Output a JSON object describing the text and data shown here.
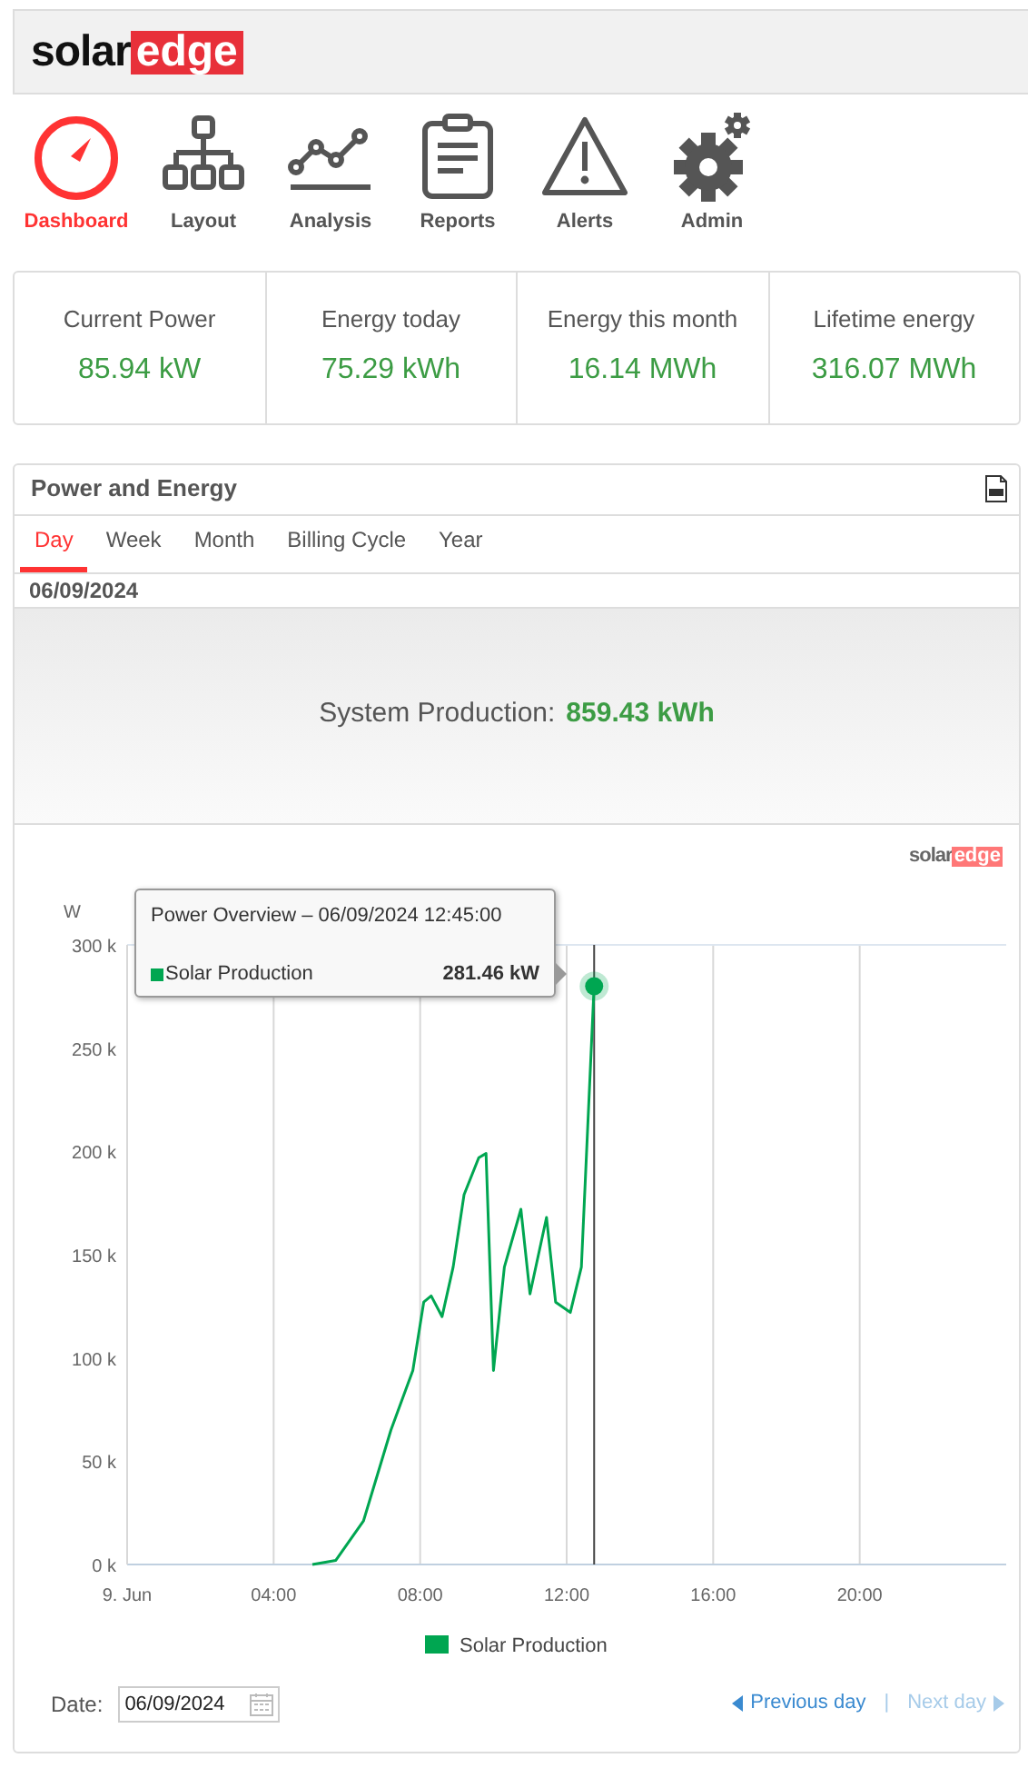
{
  "logo": {
    "part_1": "solar",
    "part_2": "edge"
  },
  "nav": [
    {
      "label": "Dashboard",
      "selected": true
    },
    {
      "label": "Layout",
      "selected": false
    },
    {
      "label": "Analysis",
      "selected": false
    },
    {
      "label": "Reports",
      "selected": false
    },
    {
      "label": "Alerts",
      "selected": false
    },
    {
      "label": "Admin",
      "selected": false
    }
  ],
  "kpis": [
    {
      "label": "Current Power",
      "value": "85.94 kW"
    },
    {
      "label": "Energy today",
      "value": "75.29 kWh"
    },
    {
      "label": "Energy this month",
      "value": "16.14 MWh"
    },
    {
      "label": "Lifetime energy",
      "value": "316.07 MWh"
    }
  ],
  "panel": {
    "title": "Power and Energy",
    "tabs": [
      {
        "label": "Day",
        "selected": true
      },
      {
        "label": "Week",
        "selected": false
      },
      {
        "label": "Month",
        "selected": false
      },
      {
        "label": "Billing Cycle",
        "selected": false
      },
      {
        "label": "Year",
        "selected": false
      }
    ],
    "date": "06/09/2024",
    "production": {
      "label": "System Production:",
      "value": "859.43 kWh"
    },
    "chart_logo": {
      "part_1": "solar",
      "part_2": "edge"
    },
    "chart_data": {
      "type": "line",
      "ylabel": "W",
      "grid": true,
      "x": [
        5.06,
        5.7,
        6.45,
        7.2,
        7.8,
        8.1,
        8.3,
        8.6,
        8.9,
        9.2,
        9.6,
        9.8,
        10.0,
        10.3,
        10.75,
        11.0,
        11.45,
        11.7,
        12.1,
        12.4,
        12.75
      ],
      "series": [
        {
          "name": "Solar Production",
          "color": "#00a651",
          "values": [
            0,
            2000,
            21000,
            65000,
            94000,
            127000,
            130000,
            120000,
            144000,
            179000,
            197000,
            199000,
            94000,
            144000,
            172000,
            131000,
            168000,
            127000,
            122000,
            144000,
            280000
          ]
        }
      ],
      "xlim": [
        0,
        24
      ],
      "ylim": [
        0,
        300000
      ],
      "xticks": [
        {
          "value": 0,
          "label": "9. Jun"
        },
        {
          "value": 4,
          "label": "04:00"
        },
        {
          "value": 8,
          "label": "08:00"
        },
        {
          "value": 12,
          "label": "12:00"
        },
        {
          "value": 16,
          "label": "16:00"
        },
        {
          "value": 20,
          "label": "20:00"
        }
      ],
      "yticks": [
        {
          "value": 0,
          "label": "0 k"
        },
        {
          "value": 50000,
          "label": "50 k"
        },
        {
          "value": 100000,
          "label": "100 k"
        },
        {
          "value": 150000,
          "label": "150 k"
        },
        {
          "value": 200000,
          "label": "200 k"
        },
        {
          "value": 250000,
          "label": "250 k"
        },
        {
          "value": 300000,
          "label": "300 k"
        }
      ],
      "ref_lines": [
        {
          "axis": "x",
          "value": 12.75
        }
      ]
    },
    "tooltip": {
      "title": "Power Overview – 06/09/2024 12:45:00",
      "series": "Solar Production",
      "value": "281.46 kW"
    },
    "date_label": "Date:",
    "date_value": "06/09/2024",
    "prev_link": {
      "label": "Previous day",
      "disabled": false
    },
    "separator": "|",
    "next_link": {
      "label": "Next day",
      "disabled": true
    }
  }
}
